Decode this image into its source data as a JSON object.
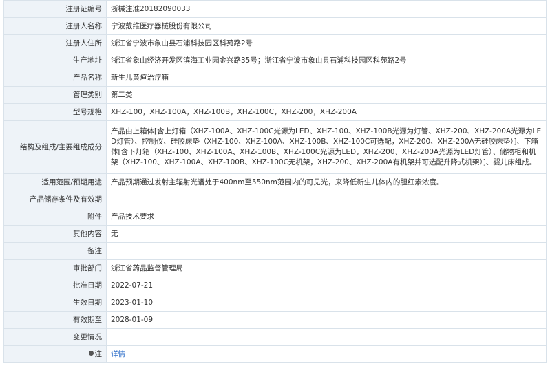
{
  "rows": [
    {
      "label": "注册证编号",
      "value": "浙械注准20182090033"
    },
    {
      "label": "注册人名称",
      "value": "宁波戴维医疗器械股份有限公司"
    },
    {
      "label": "注册人住所",
      "value": "浙江省宁波市象山县石浦科技园区科苑路2号"
    },
    {
      "label": "生产地址",
      "value": "浙江省象山经济开发区滨海工业园金兴路35号；浙江省宁波市象山县石浦科技园区科苑路2号"
    },
    {
      "label": "产品名称",
      "value": "新生儿黄疸治疗箱"
    },
    {
      "label": "管理类别",
      "value": "第二类"
    },
    {
      "label": "型号规格",
      "value": "XHZ-100，XHZ-100A，XHZ-100B，XHZ-100C，XHZ-200，XHZ-200A"
    },
    {
      "label": "结构及组成/主要组成成分",
      "value": "产品由上箱体[含上灯箱（XHZ-100A、XHZ-100C光源为LED、XHZ-100、XHZ-100B光源为灯管、XHZ-200、XHZ-200A光源为LED灯管）、控制仪、硅胶床垫（XHZ-100、XHZ-100A、XHZ-100B、XHZ-100C可选配，XHZ-200、XHZ-200A无硅胶床垫）]、下箱体[含下灯箱（XHZ-100、XHZ-100A、XHZ-100B、XHZ-100C光源为LED，XHZ-200、XHZ-200A光源为LED灯管）、储物柜和机架（XHZ-100、XHZ-100A、XHZ-100B、XHZ-100C无机架，XHZ-200、XHZ-200A有机架并可选配升降式机架）]、婴儿床组成。"
    },
    {
      "label": "适用范围/预期用途",
      "value": "产品预期通过发射主辐射光谱处于400nm至550nm范围内的可见光，来降低新生儿体内的胆红素浓度。"
    },
    {
      "label": "产品储存条件及有效期",
      "value": ""
    },
    {
      "label": "附件",
      "value": "产品技术要求"
    },
    {
      "label": "其他内容",
      "value": "无"
    },
    {
      "label": "备注",
      "value": ""
    },
    {
      "label": "审批部门",
      "value": "浙江省药品监督管理局"
    },
    {
      "label": "批准日期",
      "value": "2022-07-21"
    },
    {
      "label": "生效日期",
      "value": "2023-01-10"
    },
    {
      "label": "有效期至",
      "value": "2028-01-09"
    },
    {
      "label": "变更情况",
      "value": ""
    }
  ],
  "note": {
    "label": "注",
    "link_text": "详情",
    "icon": "info-dot-icon"
  }
}
